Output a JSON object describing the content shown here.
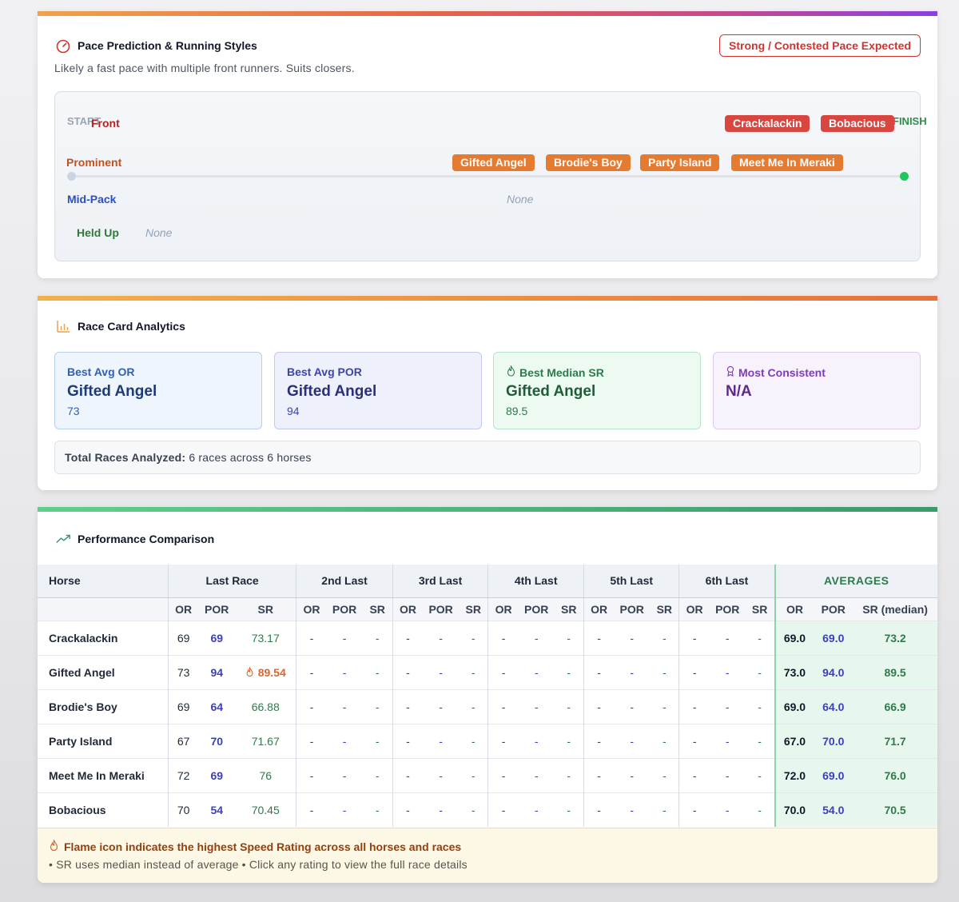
{
  "pace": {
    "title": "Pace Prediction & Running Styles",
    "badge": "Strong / Contested Pace Expected",
    "description": "Likely a fast pace with multiple front runners. Suits closers.",
    "start_label": "START",
    "finish_label": "FINISH",
    "groups": {
      "front": {
        "label": "Front",
        "horses": [
          "Crackalackin",
          "Bobacious"
        ]
      },
      "prominent": {
        "label": "Prominent",
        "horses": [
          "Gifted Angel",
          "Brodie's Boy",
          "Party Island",
          "Meet Me In Meraki"
        ]
      },
      "midpack": {
        "label": "Mid-Pack",
        "none": "None"
      },
      "heldup": {
        "label": "Held Up",
        "none": "None"
      }
    }
  },
  "analytics": {
    "title": "Race Card Analytics",
    "stats": [
      {
        "label": "Best Avg OR",
        "name": "Gifted Angel",
        "value": "73"
      },
      {
        "label": "Best Avg POR",
        "name": "Gifted Angel",
        "value": "94"
      },
      {
        "label": "Best Median SR",
        "name": "Gifted Angel",
        "value": "89.5"
      },
      {
        "label": "Most Consistent",
        "name": "N/A",
        "value": ""
      }
    ],
    "total_label": "Total Races Analyzed:",
    "total_value": "6 races across 6 horses"
  },
  "performance": {
    "title": "Performance Comparison",
    "headers": {
      "horse": "Horse",
      "groups": [
        "Last Race",
        "2nd Last",
        "3rd Last",
        "4th Last",
        "5th Last",
        "6th Last"
      ],
      "averages": "AVERAGES",
      "sub": [
        "OR",
        "POR",
        "SR"
      ],
      "avg_sub": [
        "OR",
        "POR",
        "SR (median)"
      ]
    },
    "rows": [
      {
        "horse": "Crackalackin",
        "or": "69",
        "por": "69",
        "sr": "73.17",
        "avg_or": "69.0",
        "avg_por": "69.0",
        "avg_sr": "73.2"
      },
      {
        "horse": "Gifted Angel",
        "or": "73",
        "por": "94",
        "sr": "89.54",
        "avg_or": "73.0",
        "avg_por": "94.0",
        "avg_sr": "89.5"
      },
      {
        "horse": "Brodie's Boy",
        "or": "69",
        "por": "64",
        "sr": "66.88",
        "avg_or": "69.0",
        "avg_por": "64.0",
        "avg_sr": "66.9"
      },
      {
        "horse": "Party Island",
        "or": "67",
        "por": "70",
        "sr": "71.67",
        "avg_or": "67.0",
        "avg_por": "70.0",
        "avg_sr": "71.7"
      },
      {
        "horse": "Meet Me In Meraki",
        "or": "72",
        "por": "69",
        "sr": "76",
        "avg_or": "72.0",
        "avg_por": "69.0",
        "avg_sr": "76.0"
      },
      {
        "horse": "Bobacious",
        "or": "70",
        "por": "54",
        "sr": "70.45",
        "avg_or": "70.0",
        "avg_por": "54.0",
        "avg_sr": "70.5"
      }
    ],
    "empty_value": "-",
    "footer_note": "Flame icon indicates the highest Speed Rating across all horses and races",
    "footer_sub": "• SR uses median instead of average • Click any rating to view the full race details"
  },
  "colors": {
    "accent_red": "#d1342f",
    "accent_orange": "#e57b30",
    "por_blue": "#3b3fb8",
    "sr_green": "#2f7a4c"
  }
}
